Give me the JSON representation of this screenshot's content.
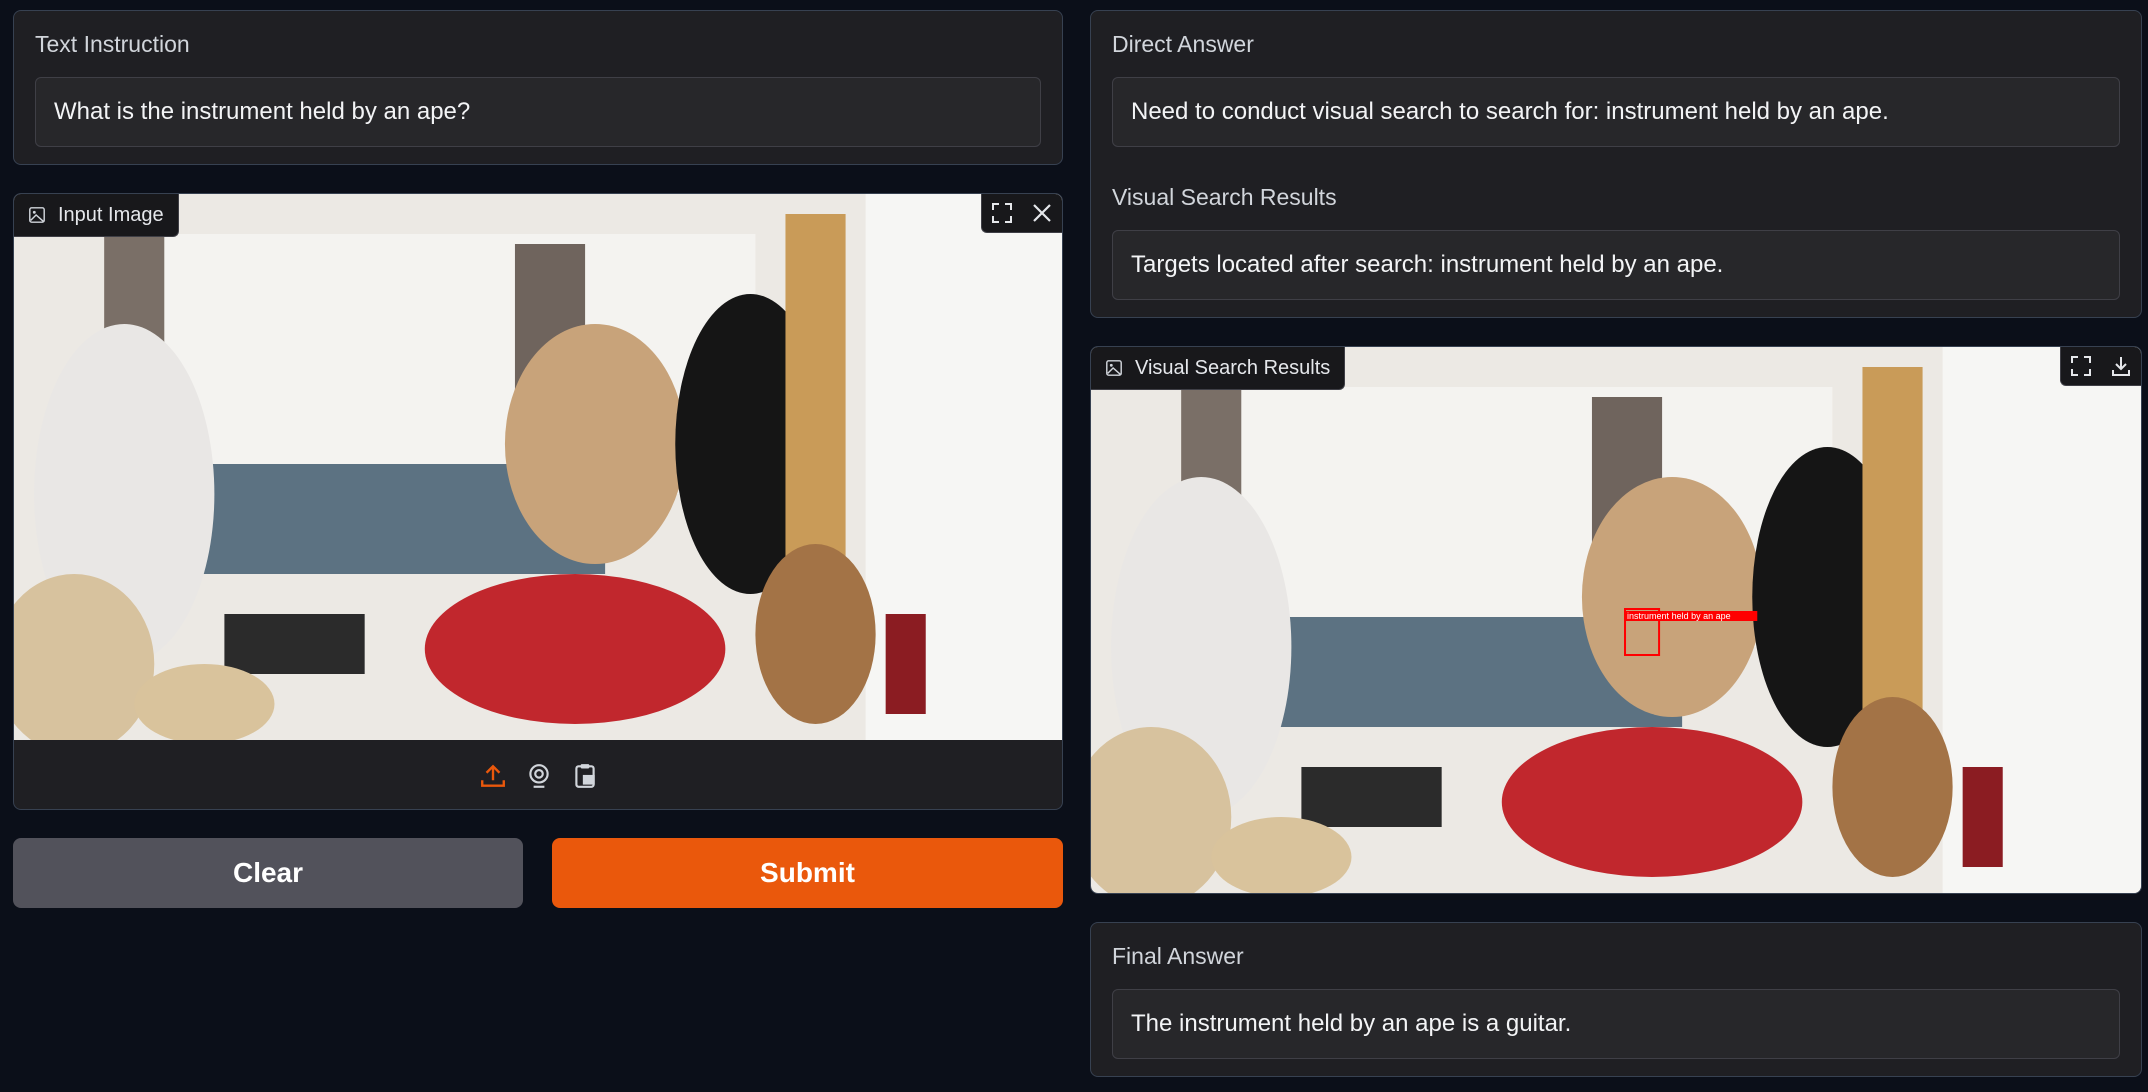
{
  "instruction": {
    "label": "Text Instruction",
    "value": "What is the instrument held by an ape?"
  },
  "input_image": {
    "label": "Input Image",
    "tools": [
      "fullscreen-icon",
      "close-icon"
    ],
    "sources": [
      "upload-icon",
      "webcam-icon",
      "clipboard-icon"
    ]
  },
  "actions": {
    "clear_label": "Clear",
    "submit_label": "Submit"
  },
  "direct_answer": {
    "label": "Direct Answer",
    "value": "Need to conduct visual search to search for: instrument held by an ape."
  },
  "search_text": {
    "label": "Visual Search Results",
    "value": "Targets located after search: instrument held by an ape."
  },
  "search_image": {
    "label": "Visual Search Results",
    "tools": [
      "fullscreen-icon",
      "download-icon"
    ],
    "detection_label": "instrument held by an ape"
  },
  "final_answer": {
    "label": "Final Answer",
    "value": "The instrument held by an ape is a guitar."
  },
  "colors": {
    "background": "#0b0f19",
    "panel": "#1f1f23",
    "accent": "#ea580c",
    "secondary_button": "#52525b",
    "detection_box": "#ff0000"
  }
}
